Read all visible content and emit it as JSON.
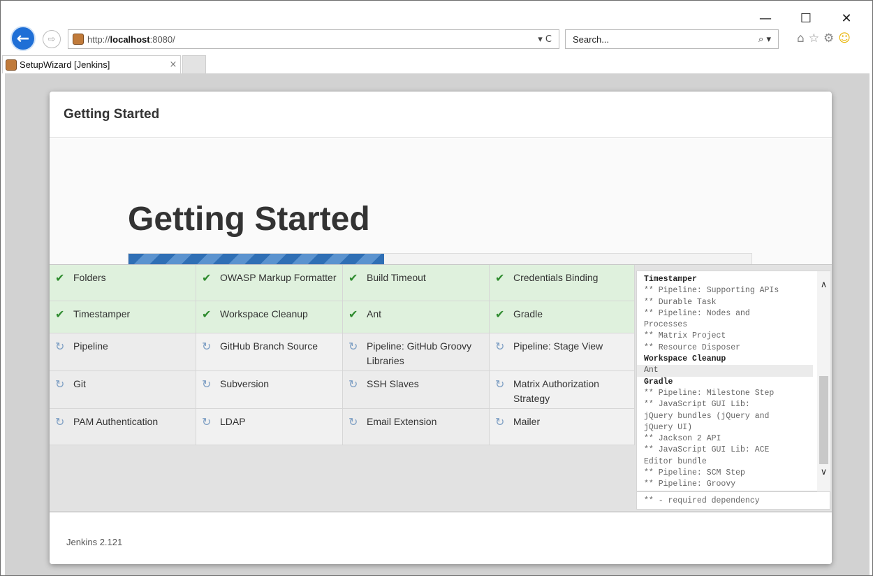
{
  "window": {
    "controls": {
      "minimize": "—",
      "maximize": "☐",
      "close": "✕"
    }
  },
  "nav": {
    "back_icon": "←",
    "forward_icon": "⇨",
    "url_prefix": "http://",
    "url_host": "localhost",
    "url_suffix": ":8080/",
    "addr_actions": "▾ C",
    "search_placeholder": "Search...",
    "search_icon": "⌕ ▾",
    "tool_icons": {
      "home": "⌂",
      "favorites": "☆",
      "settings": "⚙",
      "feedback": "☺"
    }
  },
  "tabs": [
    {
      "title": "SetupWizard [Jenkins]",
      "close": "×"
    }
  ],
  "dialog": {
    "header_title": "Getting Started",
    "hero_title": "Getting Started",
    "progress_fraction": 0.41,
    "footer_version": "Jenkins 2.121"
  },
  "plugins": [
    [
      {
        "name": "Folders",
        "status": "done"
      },
      {
        "name": "OWASP Markup Formatter",
        "status": "done"
      },
      {
        "name": "Build Timeout",
        "status": "done"
      },
      {
        "name": "Credentials Binding",
        "status": "done"
      }
    ],
    [
      {
        "name": "Timestamper",
        "status": "done"
      },
      {
        "name": "Workspace Cleanup",
        "status": "done"
      },
      {
        "name": "Ant",
        "status": "done"
      },
      {
        "name": "Gradle",
        "status": "done"
      }
    ],
    [
      {
        "name": "Pipeline",
        "status": "pending"
      },
      {
        "name": "GitHub Branch Source",
        "status": "pending"
      },
      {
        "name": "Pipeline: GitHub Groovy Libraries",
        "status": "pending"
      },
      {
        "name": "Pipeline: Stage View",
        "status": "pending"
      }
    ],
    [
      {
        "name": "Git",
        "status": "pending"
      },
      {
        "name": "Subversion",
        "status": "pending"
      },
      {
        "name": "SSH Slaves",
        "status": "pending"
      },
      {
        "name": "Matrix Authorization Strategy",
        "status": "pending"
      }
    ],
    [
      {
        "name": "PAM Authentication",
        "status": "pending"
      },
      {
        "name": "LDAP",
        "status": "pending"
      },
      {
        "name": "Email Extension",
        "status": "pending"
      },
      {
        "name": "Mailer",
        "status": "pending"
      }
    ]
  ],
  "icons": {
    "done": "✔",
    "pending": "↻"
  },
  "log": {
    "lines": [
      {
        "text": "Timestamper",
        "kind": "hdr"
      },
      {
        "text": "** Pipeline: Supporting APIs",
        "kind": "dep"
      },
      {
        "text": "** Durable Task",
        "kind": "dep"
      },
      {
        "text": "** Pipeline: Nodes and",
        "kind": "dep"
      },
      {
        "text": "Processes",
        "kind": "dep"
      },
      {
        "text": "** Matrix Project",
        "kind": "dep"
      },
      {
        "text": "** Resource Disposer",
        "kind": "dep"
      },
      {
        "text": "Workspace Cleanup",
        "kind": "hdr"
      },
      {
        "text": "Ant",
        "kind": "hl"
      },
      {
        "text": "Gradle",
        "kind": "hdr"
      },
      {
        "text": "** Pipeline: Milestone Step",
        "kind": "dep"
      },
      {
        "text": "** JavaScript GUI Lib:",
        "kind": "dep"
      },
      {
        "text": "jQuery bundles (jQuery and",
        "kind": "dep"
      },
      {
        "text": "jQuery UI)",
        "kind": "dep"
      },
      {
        "text": "** Jackson 2 API",
        "kind": "dep"
      },
      {
        "text": "** JavaScript GUI Lib: ACE",
        "kind": "dep"
      },
      {
        "text": "Editor bundle",
        "kind": "dep"
      },
      {
        "text": "** Pipeline: SCM Step",
        "kind": "dep"
      },
      {
        "text": "** Pipeline: Groovy",
        "kind": "dep"
      }
    ],
    "scroll_up": "∧",
    "scroll_down": "∨",
    "footer": "** - required dependency"
  },
  "colors": {
    "done_bg": "#dff1dd",
    "pending_bg": "#ececec",
    "check": "#2e8b2e",
    "progress": "#2f6fb5"
  }
}
